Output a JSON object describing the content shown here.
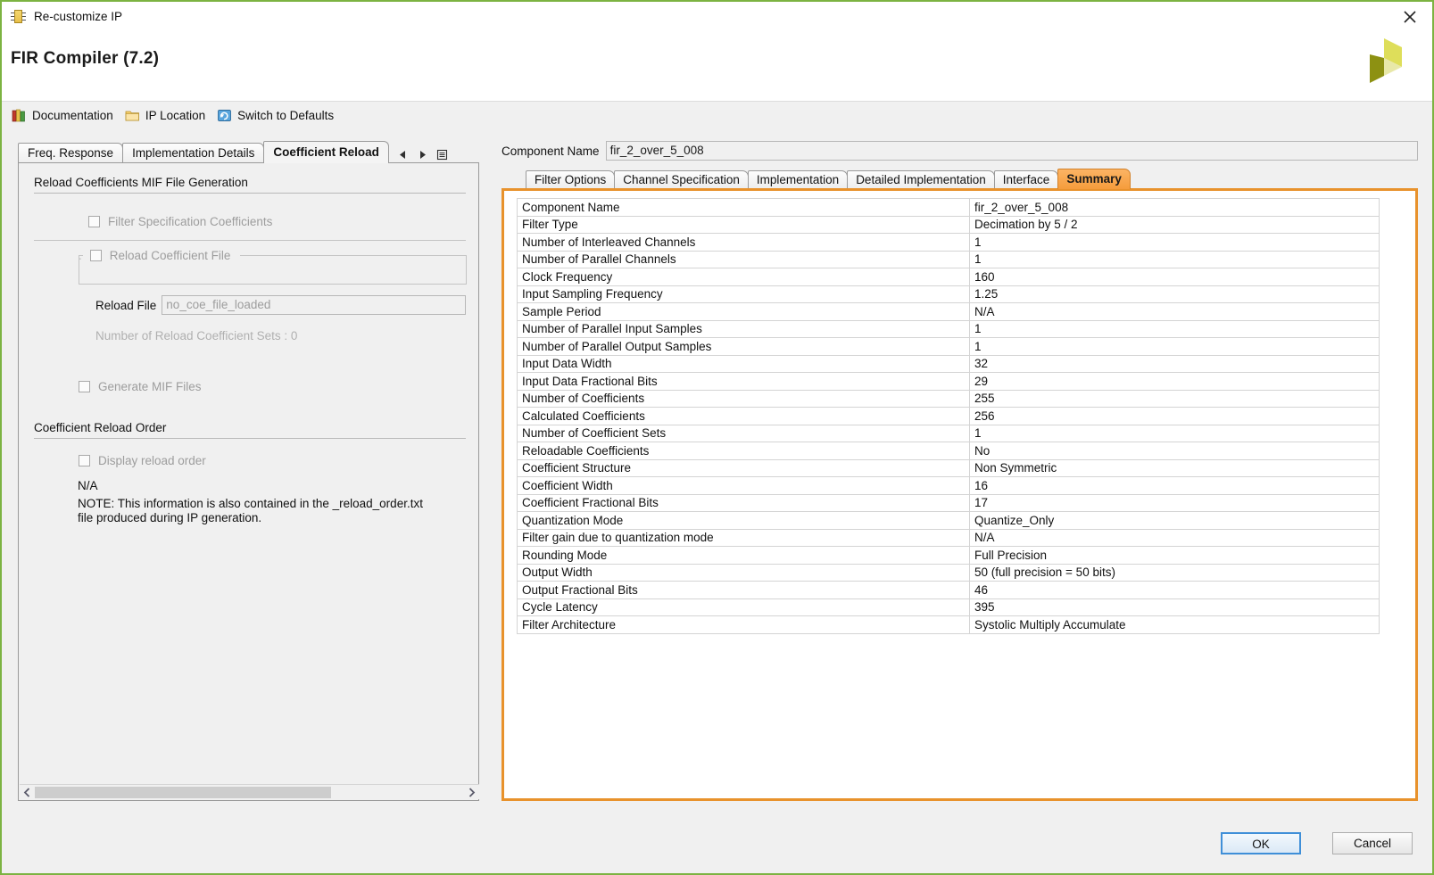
{
  "window": {
    "title": "Re-customize IP",
    "icon": "ip-chip-icon",
    "close_icon": "close-icon",
    "accent_border": "#7cb342"
  },
  "header": {
    "product_title": "FIR Compiler (7.2)",
    "logo": "xilinx-logo"
  },
  "toolbar": {
    "items": [
      {
        "label": "Documentation",
        "icon": "books-icon"
      },
      {
        "label": "IP Location",
        "icon": "folder-icon"
      },
      {
        "label": "Switch to Defaults",
        "icon": "refresh-icon"
      }
    ]
  },
  "left_panel": {
    "tabs": [
      {
        "label": "Freq. Response",
        "active": false
      },
      {
        "label": "Implementation Details",
        "active": false
      },
      {
        "label": "Coefficient Reload",
        "active": true
      }
    ],
    "nav": {
      "prev_icon": "triangle-left-icon",
      "next_icon": "triangle-right-icon",
      "list_icon": "tab-list-icon"
    },
    "sections": [
      {
        "title": "Reload Coefficients MIF File Generation"
      },
      {
        "title": "Coefficient Reload Order"
      }
    ],
    "checkboxes": [
      {
        "label": "Filter Specification Coefficients",
        "checked": false,
        "disabled": true
      },
      {
        "label": "Reload Coefficient File",
        "checked": false,
        "disabled": true
      },
      {
        "label": "Generate MIF Files",
        "checked": false,
        "disabled": true
      },
      {
        "label": "Display reload order",
        "checked": false,
        "disabled": true
      }
    ],
    "reload_file": {
      "label": "Reload File",
      "value": "no_coe_file_loaded"
    },
    "reload_sets_text": "Number of Reload Coefficient Sets : 0",
    "reload_order_value": "N/A",
    "note_line_1": "NOTE: This information is also contained in the _reload_order.txt",
    "note_line_2": "file produced during IP generation.",
    "scrollbar": {
      "left_arrow_icon": "chevron-left-icon",
      "right_arrow_icon": "chevron-right-icon"
    }
  },
  "right_panel": {
    "component_name_label": "Component Name",
    "component_name_value": "fir_2_over_5_008",
    "tabs": [
      {
        "label": "Filter Options",
        "active": false
      },
      {
        "label": "Channel Specification",
        "active": false
      },
      {
        "label": "Implementation",
        "active": false
      },
      {
        "label": "Detailed Implementation",
        "active": false
      },
      {
        "label": "Interface",
        "active": false
      },
      {
        "label": "Summary",
        "active": true
      }
    ],
    "active_tab_color": "#f59c3c",
    "panel_border_color": "#e8922c",
    "summary_rows": [
      {
        "key": "Component Name",
        "value": "fir_2_over_5_008"
      },
      {
        "key": "Filter Type",
        "value": "Decimation by 5 / 2"
      },
      {
        "key": "Number of Interleaved Channels",
        "value": "1"
      },
      {
        "key": "Number of Parallel Channels",
        "value": "1"
      },
      {
        "key": "Clock Frequency",
        "value": "160"
      },
      {
        "key": "Input Sampling Frequency",
        "value": "1.25"
      },
      {
        "key": "Sample Period",
        "value": "N/A"
      },
      {
        "key": "Number of Parallel Input Samples",
        "value": "1"
      },
      {
        "key": "Number of Parallel Output Samples",
        "value": "1"
      },
      {
        "key": "Input Data Width",
        "value": "32"
      },
      {
        "key": "Input Data Fractional Bits",
        "value": "29"
      },
      {
        "key": "Number of Coefficients",
        "value": "255"
      },
      {
        "key": "Calculated Coefficients",
        "value": "256"
      },
      {
        "key": "Number of Coefficient Sets",
        "value": "1"
      },
      {
        "key": "Reloadable Coefficients",
        "value": "No"
      },
      {
        "key": "Coefficient Structure",
        "value": "Non Symmetric"
      },
      {
        "key": "Coefficient Width",
        "value": "16"
      },
      {
        "key": "Coefficient Fractional Bits",
        "value": "17"
      },
      {
        "key": "Quantization Mode",
        "value": "Quantize_Only"
      },
      {
        "key": "Filter gain due to quantization mode",
        "value": "N/A"
      },
      {
        "key": "Rounding Mode",
        "value": "Full Precision"
      },
      {
        "key": "Output Width",
        "value": "50 (full precision = 50 bits)"
      },
      {
        "key": "Output Fractional Bits",
        "value": "46"
      },
      {
        "key": "Cycle Latency",
        "value": "395"
      },
      {
        "key": "Filter Architecture",
        "value": "Systolic Multiply Accumulate"
      }
    ]
  },
  "footer": {
    "ok_label": "OK",
    "cancel_label": "Cancel"
  }
}
